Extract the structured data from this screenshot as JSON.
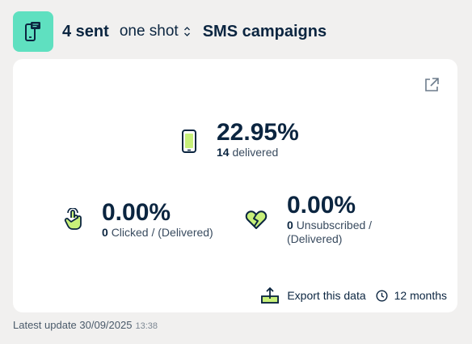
{
  "header": {
    "sent_count": "4 sent",
    "campaign_type": "one shot",
    "section_title": "SMS campaigns"
  },
  "metrics": {
    "delivered": {
      "value": "22.95%",
      "count": "14",
      "label": "delivered"
    },
    "clicked": {
      "value": "0.00%",
      "count": "0",
      "label": "Clicked / (Delivered)"
    },
    "unsubscribed": {
      "value": "0.00%",
      "count": "0",
      "label": "Unsubscribed / (Delivered)"
    }
  },
  "actions": {
    "export_label": "Export this data",
    "period_label": "12 months"
  },
  "footer": {
    "last_update_label": "Latest update 30/09/2025",
    "last_update_time": "13:38"
  },
  "colors": {
    "accent": "#5fe0c0",
    "icon_fill": "#c8f07a",
    "text": "#0b2540",
    "background": "#f1f0ef"
  },
  "icons": [
    "sms-phone-icon",
    "sort-arrows-icon",
    "external-link-icon",
    "phone-icon",
    "tap-hand-icon",
    "broken-heart-icon",
    "export-upload-icon",
    "clock-icon"
  ]
}
